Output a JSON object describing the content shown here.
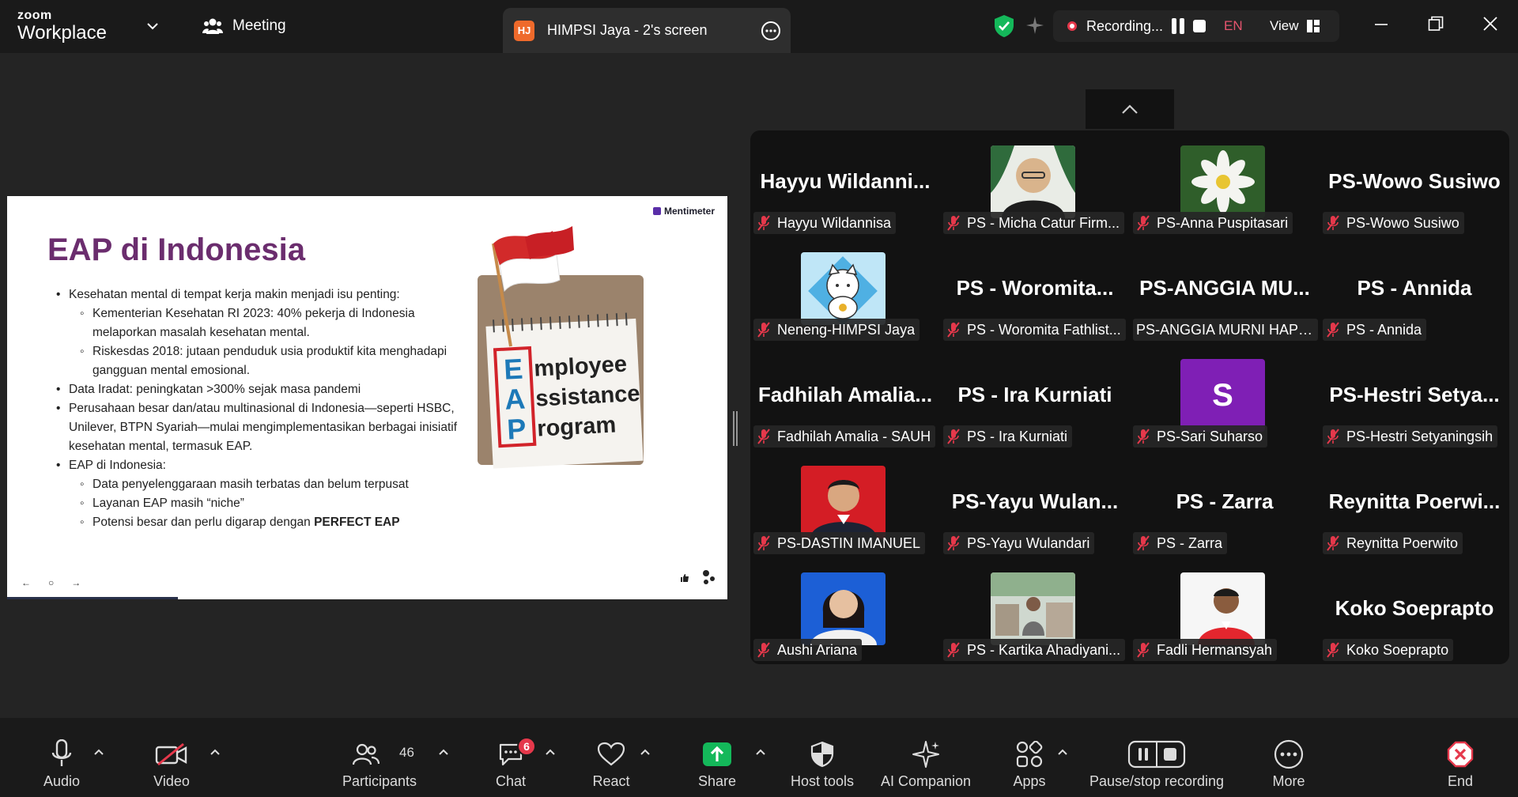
{
  "app": {
    "brand_line1": "zoom",
    "brand_line2": "Workplace"
  },
  "tabs": {
    "meeting_label": "Meeting",
    "share_badge": "HJ",
    "share_title": "HIMPSI Jaya - 2's screen"
  },
  "recording": {
    "status": "Recording...",
    "language": "EN",
    "view_label": "View"
  },
  "slide": {
    "brand": "Mentimeter",
    "title": "EAP di Indonesia",
    "bullets": [
      {
        "level": 1,
        "text": "Kesehatan mental di tempat kerja makin menjadi isu penting:"
      },
      {
        "level": 2,
        "text": "Kementerian Kesehatan RI 2023: 40% pekerja di Indonesia melaporkan masalah kesehatan mental."
      },
      {
        "level": 2,
        "text": "Riskesdas 2018: jutaan penduduk usia produktif kita menghadapi gangguan mental emosional."
      },
      {
        "level": 1,
        "text": "Data Iradat: peningkatan >300% sejak masa pandemi"
      },
      {
        "level": 1,
        "text": "Perusahaan besar dan/atau multinasional di Indonesia—seperti HSBC, Unilever, BTPN Syariah—mulai mengimplementasikan berbagai inisiatif kesehatan mental, termasuk EAP."
      },
      {
        "level": 1,
        "text": "EAP di Indonesia:"
      },
      {
        "level": 2,
        "text": "Data penyelenggaraan masih terbatas dan belum terpusat"
      },
      {
        "level": 2,
        "text": "Layanan EAP masih “niche”"
      }
    ],
    "last_bullet_prefix": "Potensi besar dan perlu digarap dengan ",
    "last_bullet_bold": "PERFECT EAP",
    "image_letters": [
      "E",
      "A",
      "P"
    ],
    "image_words": [
      "mployee",
      "ssistance",
      "rogram"
    ],
    "nav_prev": "←",
    "nav_dot": "○",
    "nav_next": "→"
  },
  "participants_tiles": [
    {
      "big": "Hayyu  Wildanni...",
      "name": "Hayyu Wildannisa",
      "avatar": null
    },
    {
      "big": null,
      "name": "PS - Micha Catur Firm...",
      "avatar": "man-glasses"
    },
    {
      "big": null,
      "name": "PS-Anna Puspitasari",
      "avatar": "white-flower"
    },
    {
      "big": "PS-Wowo Susiwo",
      "name": "PS-Wowo Susiwo",
      "avatar": null
    },
    {
      "big": null,
      "name": "Neneng-HIMPSI Jaya",
      "avatar": "lucky-cat"
    },
    {
      "big": "PS  -  Woromita...",
      "name": "PS - Woromita Fathlist...",
      "avatar": null
    },
    {
      "big": "PS-ANGGIA  MU...",
      "name": "PS-ANGGIA MURNI HAPS...",
      "avatar": null,
      "no_mic": true
    },
    {
      "big": "PS - Annida",
      "name": "PS - Annida",
      "avatar": null
    },
    {
      "big": "Fadhilah  Amalia...",
      "name": "Fadhilah Amalia - SAUH",
      "avatar": null
    },
    {
      "big": "PS - Ira Kurniati",
      "name": "PS - Ira Kurniati",
      "avatar": null
    },
    {
      "big": null,
      "name": "PS-Sari Suharso",
      "avatar": "letter-s",
      "letter": "S"
    },
    {
      "big": "PS-Hestri  Setya...",
      "name": "PS-Hestri Setyaningsih",
      "avatar": null
    },
    {
      "big": null,
      "name": "PS-DASTIN IMANUEL",
      "avatar": "red-portrait"
    },
    {
      "big": "PS-Yayu  Wulan...",
      "name": "PS-Yayu Wulandari",
      "avatar": null
    },
    {
      "big": "PS - Zarra",
      "name": "PS - Zarra",
      "avatar": null
    },
    {
      "big": "Reynitta  Poerwi...",
      "name": "Reynitta Poerwito",
      "avatar": null
    },
    {
      "big": null,
      "name": "Aushi Ariana",
      "avatar": "blue-portrait"
    },
    {
      "big": null,
      "name": "PS - Kartika Ahadiyani...",
      "avatar": "cafe-photo"
    },
    {
      "big": null,
      "name": "Fadli Hermansyah",
      "avatar": "white-portrait"
    },
    {
      "big": "Koko Soeprapto",
      "name": "Koko Soeprapto",
      "avatar": null
    }
  ],
  "toolbar": {
    "audio": "Audio",
    "video": "Video",
    "participants": "Participants",
    "participants_count": "46",
    "chat": "Chat",
    "chat_badge": "6",
    "react": "React",
    "share": "Share",
    "host_tools": "Host tools",
    "ai_companion": "AI Companion",
    "apps": "Apps",
    "pause_stop": "Pause/stop recording",
    "more": "More",
    "end": "End"
  },
  "colors": {
    "accent_green": "#14b85a",
    "end_red": "#e5384b",
    "title_purple": "#6b2d6e"
  }
}
